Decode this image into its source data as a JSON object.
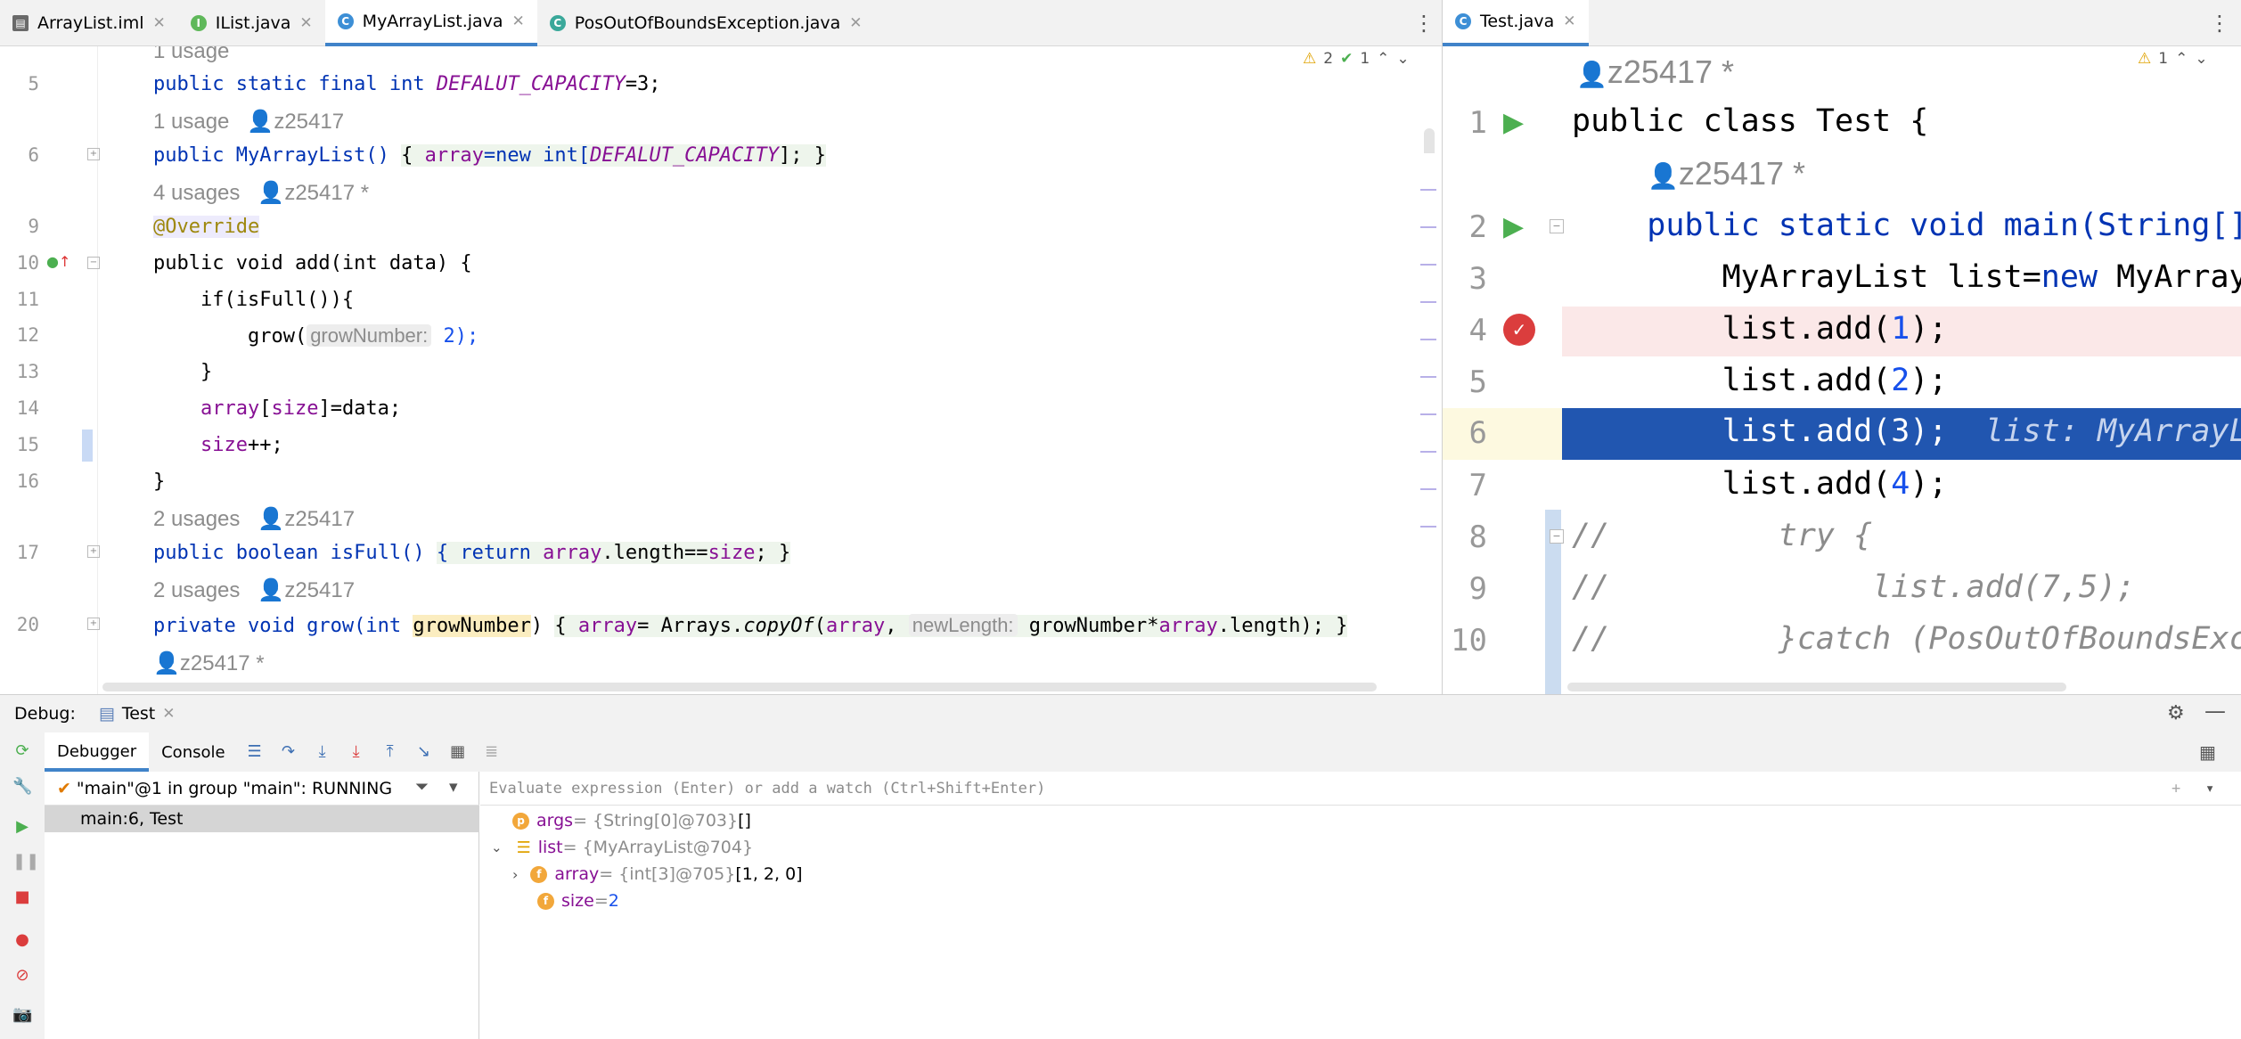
{
  "left_tabs": [
    {
      "label": "ArrayList.iml",
      "icon": "iml-file-icon",
      "active": false
    },
    {
      "label": "IList.java",
      "icon": "interface-icon",
      "active": false
    },
    {
      "label": "MyArrayList.java",
      "icon": "class-icon",
      "active": true
    },
    {
      "label": "PosOutOfBoundsException.java",
      "icon": "exception-class-icon",
      "active": false
    }
  ],
  "right_tabs": [
    {
      "label": "Test.java",
      "icon": "class-icon",
      "active": true
    }
  ],
  "left_editor": {
    "inspections": {
      "warnings": "2",
      "checks": "1"
    },
    "lines": {
      "usage1": "1 usage",
      "ln5": "5",
      "usage2": "1 usage",
      "author2": "z25417",
      "ln6": "6",
      "usage3": "4 usages",
      "author3": "z25417 *",
      "ln9": "9",
      "ln10": "10",
      "ln11": "11",
      "ln12": "12",
      "ln13": "13",
      "ln14": "14",
      "ln15": "15",
      "ln16": "16",
      "usage4": "2 usages",
      "author4": "z25417",
      "ln17": "17",
      "usage5": "2 usages",
      "author5": "z25417",
      "ln20": "20",
      "author6": "z25417 *"
    },
    "code": {
      "l5a": "public static final int ",
      "l5b": "DEFALUT_CAPACITY",
      "l5c": "=3;",
      "l6a": "public MyArrayList() ",
      "l6b": "{ ",
      "l6c": "array",
      "l6d": "=new int[",
      "l6e": "DEFALUT_CAPACITY",
      "l6f": "]; }",
      "l9": "@Override",
      "l10": "public void add(int data) {",
      "l11": "    if(isFull()){",
      "l12a": "        grow(",
      "l12b": "growNumber:",
      "l12c": " 2);",
      "l13": "    }",
      "l14a": "    ",
      "l14b": "array",
      "l14c": "[",
      "l14d": "size",
      "l14e": "]=data;",
      "l15a": "    ",
      "l15b": "size",
      "l15c": "++;",
      "l16": "}",
      "l17a": "public boolean isFull() ",
      "l17b": "{ return ",
      "l17c": "array",
      "l17d": ".length==",
      "l17e": "size",
      "l17f": "; }",
      "l20a": "private void grow(int ",
      "l20b": "growNumber",
      "l20c": ") ",
      "l20d": "{ ",
      "l20e": "array",
      "l20f": "= Arrays.",
      "l20g": "copyOf",
      "l20h": "(",
      "l20i": "array",
      "l20j": ", ",
      "l20k": "newLength:",
      "l20l": " growNumber*",
      "l20m": "array",
      "l20n": ".length); }"
    }
  },
  "right_editor": {
    "inspections": {
      "warnings": "1"
    },
    "author_top": "z25417 *",
    "author_main": "z25417 *",
    "line_numbers": [
      "1",
      "2",
      "3",
      "4",
      "5",
      "6",
      "7",
      "8",
      "9",
      "10"
    ],
    "code": {
      "r1": "public class Test {",
      "r2": "    public static void main(String[]",
      "r3a": "        MyArrayList list=",
      "r3b": "new",
      "r3c": " MyArrayL",
      "r4a": "        list.add(",
      "r4b": "1",
      "r4c": ");",
      "r5a": "        list.add(",
      "r5b": "2",
      "r5c": ");",
      "r6a": "        list.add(3);",
      "r6b": "  list: MyArrayL",
      "r7a": "        list.add(",
      "r7b": "4",
      "r7c": ");",
      "r8": "//         try {",
      "r9": "//              list.add(7,5);",
      "r10": "//         }catch (PosOutOfBoundsExc"
    }
  },
  "debug": {
    "title": "Debug:",
    "session": "Test",
    "tabs": [
      "Debugger",
      "Console"
    ],
    "thread": "\"main\"@1 in group \"main\": RUNNING",
    "frame": "main:6, Test",
    "eval_placeholder": "Evaluate expression (Enter) or add a watch (Ctrl+Shift+Enter)",
    "variables": [
      {
        "badge": "p",
        "name": "args",
        "ref": " = {String[0]@703} ",
        "value": "[]"
      },
      {
        "badge": "list",
        "name": "list",
        "ref": " = {MyArrayList@704}",
        "value": ""
      },
      {
        "badge": "f",
        "name": "array",
        "ref": " = {int[3]@705} ",
        "value": "[1, 2, 0]"
      },
      {
        "badge": "f",
        "name": "size",
        "ref": " = ",
        "value": "2"
      }
    ]
  },
  "colors": {
    "accent": "#4083c9",
    "selected_line": "#2156b0",
    "breakpoint_line": "#fbe8e8",
    "breakpoint": "#db3d3d",
    "run_green": "#4caf50"
  }
}
